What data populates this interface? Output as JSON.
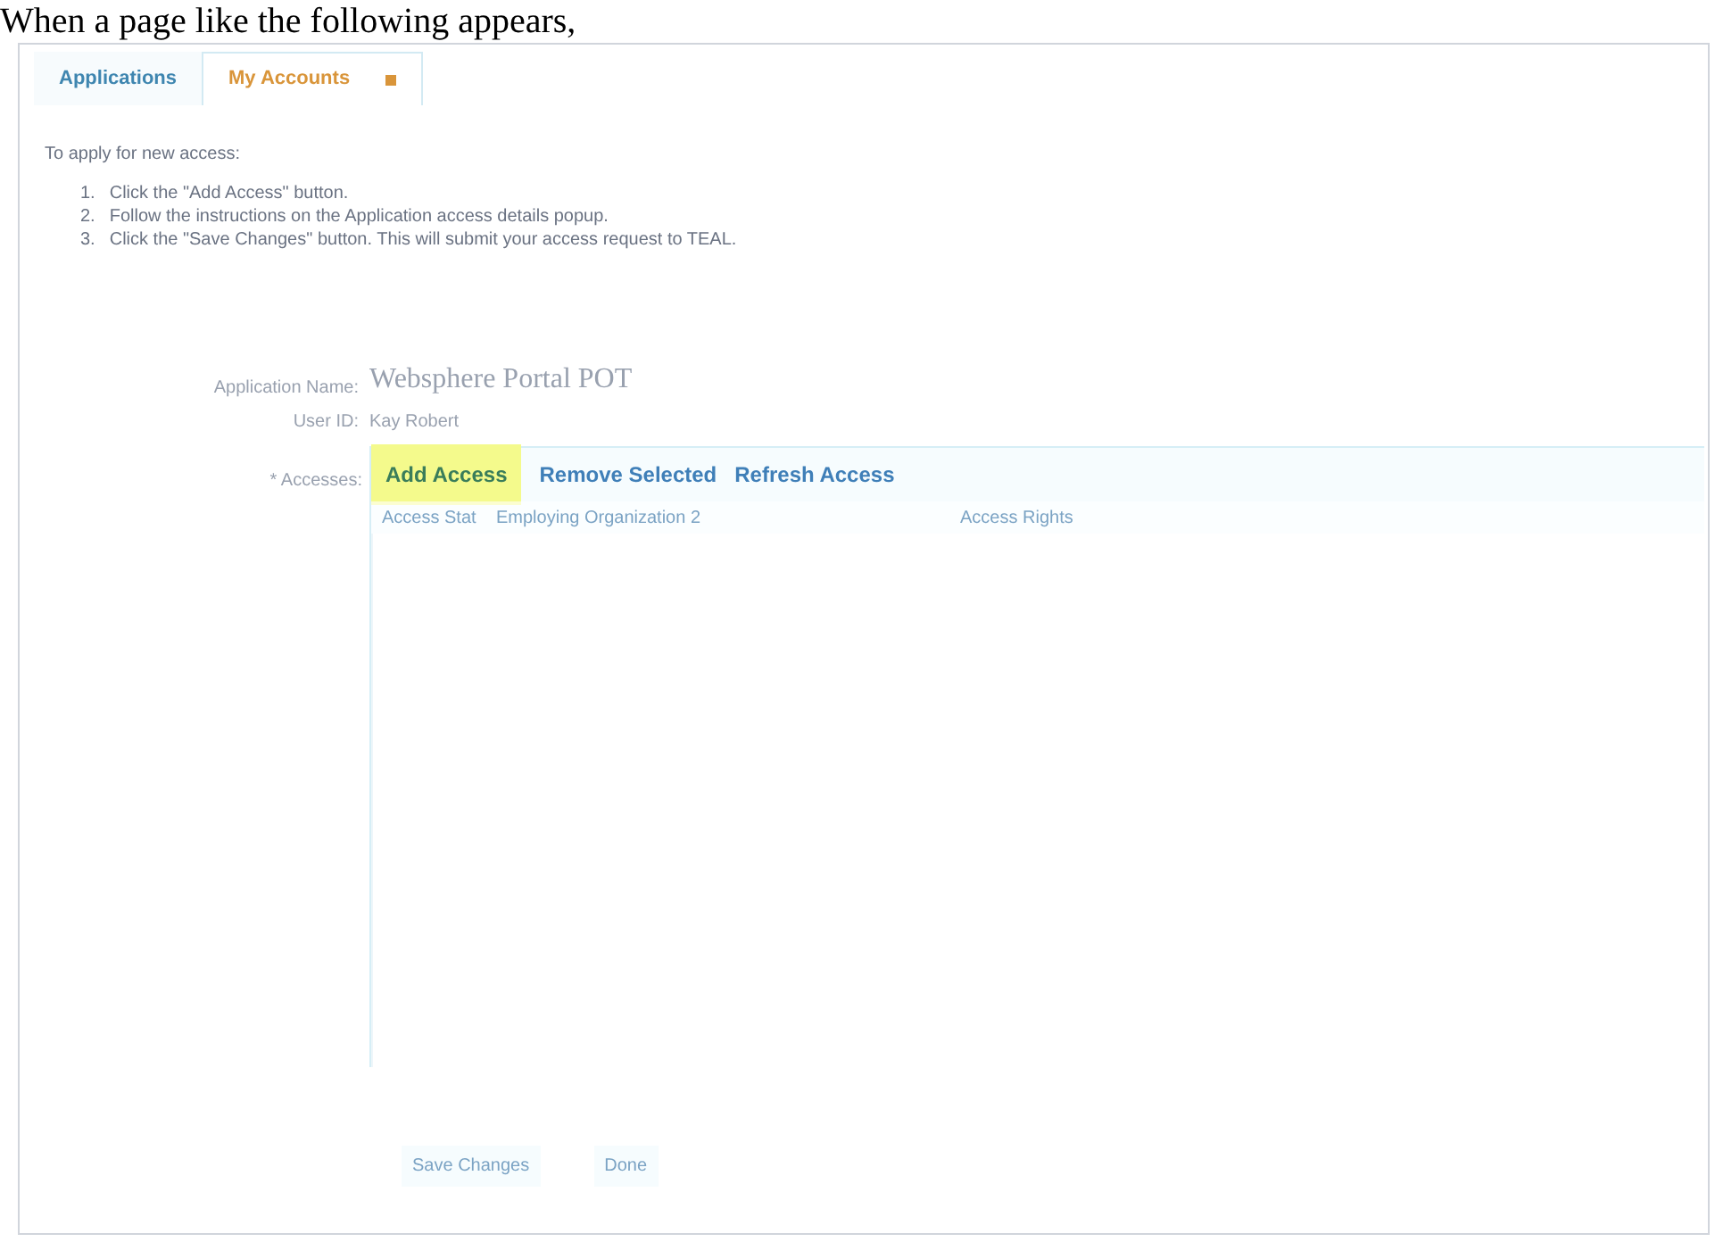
{
  "caption": "When a page like the following appears,",
  "tabs": [
    {
      "label": "Applications",
      "selected": false,
      "closable": false
    },
    {
      "label": "My Accounts",
      "selected": true,
      "closable": true
    }
  ],
  "intro": "To apply for new access:",
  "steps": [
    {
      "number": "1.",
      "text": "Click the \"Add Access\" button."
    },
    {
      "number": "2.",
      "text": "Follow the instructions on the Application access details popup."
    },
    {
      "number": "3.",
      "text": "Click the \"Save Changes\" button. This will submit your access request to TEAL."
    }
  ],
  "fields": [
    {
      "label": "Application Name:",
      "value": "Websphere Portal POT",
      "kind": "title"
    },
    {
      "label": "User ID:",
      "value": "Kay Robert",
      "kind": "plain"
    }
  ],
  "accesses": {
    "label": "* Accesses:",
    "actions": [
      {
        "label": "Add Access",
        "highlighted": true
      },
      {
        "label": "Remove Selected",
        "highlighted": false
      },
      {
        "label": "Refresh Access",
        "highlighted": false
      }
    ],
    "columns": [
      "Access Stat",
      "Employing Organization 2",
      "Access Rights"
    ]
  },
  "buttons": [
    "Save Changes",
    "Done"
  ]
}
